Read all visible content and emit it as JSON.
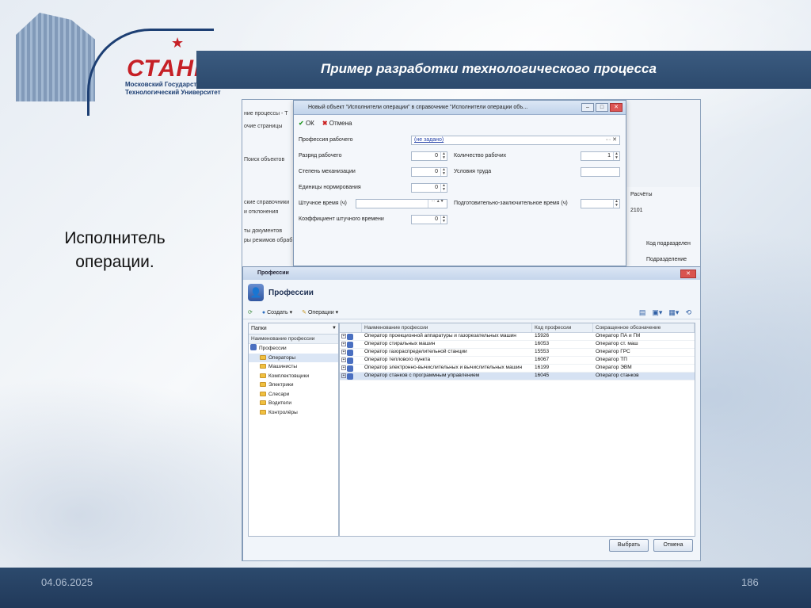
{
  "slide": {
    "title": "Пример разработки технологического процесса",
    "side_text_line1": "Исполнитель",
    "side_text_line2": "операции.",
    "date": "04.06.2025",
    "page": "186",
    "colors": {
      "band": "#2c4a6d",
      "logo_red": "#c62026",
      "logo_blue": "#1d3f73"
    }
  },
  "logo": {
    "name": "СТАНКИН",
    "subtitle_line1": "Московский Государственный",
    "subtitle_line2": "Технологический Университет"
  },
  "bg_app": {
    "left_rows": [
      "ние процессы - Т",
      "очие страницы",
      "Поиск объектов",
      "ские справочники",
      "и отклонения",
      "ты документов",
      "ры режимов обраб"
    ],
    "right_tab": "Расчёты",
    "right_value": "2101",
    "right_col1": "Код подразделен",
    "right_col2": "Подразделение"
  },
  "dialog_executor": {
    "title": "Новый объект \"Исполнители операции\" в справочнике \"Исполнители операции объ...",
    "ok_label": "ОК",
    "cancel_label": "Отмена",
    "profession_label": "Профессия рабочего",
    "profession_value": "(не задано)",
    "grade_label": "Разряд рабочего",
    "grade_value": "0",
    "workers_label": "Количество рабочих",
    "workers_value": "1",
    "mech_label": "Степень механизации",
    "mech_value": "0",
    "conditions_label": "Условия труда",
    "units_label": "Единицы нормирования",
    "units_value": "0",
    "piece_time_label": "Штучное время (ч)",
    "prep_time_label": "Подготовительно-заключительное время (ч)",
    "coef_label": "Коэффициент штучного времени",
    "coef_value": "0"
  },
  "dialog_professions": {
    "title": "Профессии",
    "header": "Профессии",
    "toolbar_create": "Создать",
    "toolbar_operations": "Операции",
    "folders_label": "Папки",
    "folders_column": "Наименование профессии",
    "tree_root": "Профессии",
    "folders": [
      "Операторы",
      "Машинисты",
      "Комплектовщики",
      "Электрики",
      "Слесари",
      "Водители",
      "Контролёры"
    ],
    "columns": {
      "name": "Наименование профессии",
      "code": "Код профессии",
      "short": "Сокращенное обозначение"
    },
    "rows": [
      {
        "name": "Оператор проекционной аппаратуры и газорезательных машин",
        "code": "15926",
        "short": "Оператор ПА и ГМ"
      },
      {
        "name": "Оператор стиральных машин",
        "code": "16053",
        "short": "Оператор ст. маш"
      },
      {
        "name": "Оператор газораспределительной станции",
        "code": "15553",
        "short": "Оператор ГРС"
      },
      {
        "name": "Оператор теплового пункта",
        "code": "16067",
        "short": "Оператор ТП"
      },
      {
        "name": "Оператор электронно-вычислительных и вычислительных машин",
        "code": "16199",
        "short": "Оператор ЭВМ"
      },
      {
        "name": "Оператор станков с программным управлением",
        "code": "16045",
        "short": "Оператор станков"
      }
    ],
    "select_label": "Выбрать",
    "cancel_label": "Отмена"
  }
}
